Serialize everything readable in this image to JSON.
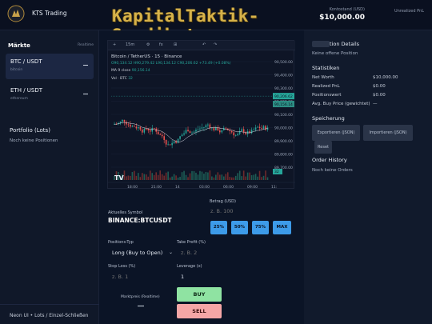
{
  "header": {
    "brand": "KTS Trading",
    "watermark_line1": "KapitalTaktik-",
    "watermark_line2": "Syndikat",
    "balance_label": "Kontostand (USD)",
    "balance_value": "$10,000.00",
    "unrealized_label": "Unrealized PnL"
  },
  "sidebar": {
    "title": "Märkte",
    "note": "Realtime",
    "markets": [
      {
        "symbol": "BTC / USDT",
        "sub": "bitcoin"
      },
      {
        "symbol": "ETH / USDT",
        "sub": "ethereum"
      }
    ],
    "portfolio_title": "Portfolio (Lots)",
    "portfolio_empty": "Noch keine Positionen",
    "footer": "Neon UI • Lots / Einzel-Schließen"
  },
  "chart": {
    "toolbar_interval": "15m",
    "toolbar_items": [
      "+",
      "15m",
      "⚙",
      "fx",
      "⊞",
      "↶",
      "↷"
    ],
    "legend": "Bitcoin / TetherUS · 15 · Binance",
    "ohlc": "O90,134.12  H90,279.42  L90,134.12  C90,206.62  +73.49 (+0.08%)",
    "ma_label": "MA 9 close",
    "ma_value": "90,156.14",
    "vol_label": "Vol · BTC",
    "vol_value": "32",
    "price_ticks": [
      "90,500.00",
      "90,400.00",
      "90,300.00",
      "90,200.00",
      "90,100.00",
      "90,000.00",
      "89,900.00",
      "89,800.00",
      "89,700.00"
    ],
    "time_ticks": [
      "18:00",
      "21:00",
      "14",
      "03:00",
      "06:00",
      "09:00",
      "11:"
    ],
    "last_price_tag": "90,206.62",
    "ma_tag": "90,156.14",
    "vol_tag": "32",
    "tv_logo": "TV"
  },
  "chart_data": {
    "type": "candlestick",
    "title": "Bitcoin / TetherUS · 15 · Binance",
    "ylim": [
      89650,
      90560
    ],
    "last": 90206.62,
    "ma9": 90156.14
  },
  "form": {
    "symbol_label": "Aktuelles Symbol",
    "symbol_value": "BINANCE:BTCUSDT",
    "amount_label": "Betrag (USD)",
    "amount_placeholder": "z. B. 100",
    "pct_buttons": [
      "25%",
      "50%",
      "75%",
      "MAX"
    ],
    "position_type_label": "Positions-Typ",
    "position_type_value": "Long (Buy to Open)",
    "take_profit_label": "Take Profit (%)",
    "take_profit_placeholder": "z. B. 2",
    "stop_loss_label": "Stop Loss (%)",
    "stop_loss_placeholder": "z. B. 1",
    "leverage_label": "Leverage (x)",
    "leverage_value": "1",
    "market_price_label": "Marktpreis (Realtime)",
    "buy_label": "BUY",
    "sell_label": "SELL"
  },
  "right": {
    "position_title": "tion Details",
    "position_text": "Keine offene Position",
    "stats_title": "Statistiken",
    "stats": [
      {
        "label": "Net Worth",
        "value": "$10,000.00"
      },
      {
        "label": "Realized PnL",
        "value": "$0.00"
      },
      {
        "label": "Positionswert",
        "value": "$0.00"
      },
      {
        "label": "Avg. Buy Price (gewichtet)",
        "value": "—"
      }
    ],
    "storage_title": "Speicherung",
    "export_label": "Exportieren (JSON)",
    "import_label": "Importieren (JSON)",
    "reset_label": "Reset",
    "order_title": "Order History",
    "order_empty": "Noch keine Orders"
  }
}
